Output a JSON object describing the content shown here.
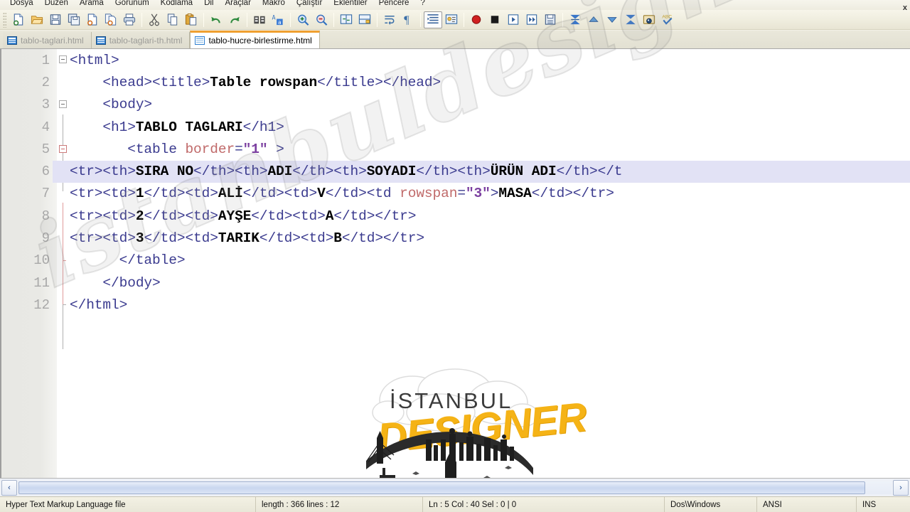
{
  "app": {
    "name": "Notepad++",
    "accent_active_tab": "#f0a030",
    "editor_bg": "#ffffff",
    "highlight_line_bg": "#e2e2f5"
  },
  "menubar": {
    "items": [
      {
        "label": "Dosya"
      },
      {
        "label": "Düzen"
      },
      {
        "label": "Arama"
      },
      {
        "label": "Görünüm"
      },
      {
        "label": "Kodlama"
      },
      {
        "label": "Dil"
      },
      {
        "label": "Araçlar"
      },
      {
        "label": "Makro"
      },
      {
        "label": "Çalıştır"
      },
      {
        "label": "Eklentiler"
      },
      {
        "label": "Pencere"
      },
      {
        "label": "?"
      }
    ]
  },
  "toolbar": {
    "groups": [
      [
        "new-file-icon",
        "open-folder-icon",
        "save-icon",
        "save-all-icon",
        "close-file-icon",
        "close-all-icon",
        "print-icon"
      ],
      [
        "cut-icon",
        "copy-icon",
        "paste-icon"
      ],
      [
        "undo-icon",
        "redo-icon"
      ],
      [
        "find-icon",
        "replace-icon"
      ],
      [
        "zoom-in-icon",
        "zoom-out-icon"
      ],
      [
        "sync-vertical-icon",
        "sync-horizontal-icon"
      ],
      [
        "word-wrap-icon",
        "show-all-chars-icon"
      ],
      [
        "indent-guide-icon",
        "user-language-icon"
      ],
      [
        "record-macro-icon",
        "stop-macro-icon",
        "play-macro-icon",
        "run-multiple-macro-icon",
        "save-macro-icon"
      ],
      [
        "collapse-all-icon",
        "collapse-level-icon",
        "expand-level-icon",
        "expand-all-icon",
        "launch-browser-icon",
        "spellcheck-icon"
      ]
    ],
    "pressed": "indent-guide-icon"
  },
  "tabs": {
    "close_label": "x",
    "items": [
      {
        "label": "tablo-taglari.html",
        "active": false,
        "icon": "html-file-icon"
      },
      {
        "label": "tablo-taglari-th.html",
        "active": false,
        "icon": "html-file-icon"
      },
      {
        "label": "tablo-hucre-birlestirme.html",
        "active": true,
        "icon": "html-file-icon"
      }
    ]
  },
  "editor": {
    "lines": [
      {
        "num": "1",
        "fold": "open",
        "highlight": false,
        "tokens": [
          {
            "t": "tk",
            "s": "<html>"
          }
        ]
      },
      {
        "num": "2",
        "fold": "none",
        "highlight": false,
        "tokens": [
          {
            "t": "tk",
            "s": "    <head><title>"
          },
          {
            "t": "txt",
            "s": "Table rowspan"
          },
          {
            "t": "tk",
            "s": "</title></head>"
          }
        ]
      },
      {
        "num": "3",
        "fold": "open",
        "highlight": false,
        "tokens": [
          {
            "t": "tk",
            "s": "    <body>"
          }
        ]
      },
      {
        "num": "4",
        "fold": "none",
        "highlight": false,
        "tokens": [
          {
            "t": "tk",
            "s": "    <h1>"
          },
          {
            "t": "txt",
            "s": "TABLO TAGLARI"
          },
          {
            "t": "tk",
            "s": "</h1>"
          }
        ]
      },
      {
        "num": "5",
        "fold": "open-active",
        "highlight": false,
        "tokens": [
          {
            "t": "tk",
            "s": "       <table "
          },
          {
            "t": "attr",
            "s": "border"
          },
          {
            "t": "tk",
            "s": "="
          },
          {
            "t": "val",
            "s": "\"1\""
          },
          {
            "t": "tk",
            "s": " >"
          }
        ]
      },
      {
        "num": "6",
        "fold": "none",
        "highlight": true,
        "tokens": [
          {
            "t": "tk",
            "s": "<tr><th>"
          },
          {
            "t": "txt",
            "s": "SIRA NO"
          },
          {
            "t": "tk",
            "s": "</th><th>"
          },
          {
            "t": "txt",
            "s": "ADI"
          },
          {
            "t": "tk",
            "s": "</th><th>"
          },
          {
            "t": "txt",
            "s": "SOYADI"
          },
          {
            "t": "tk",
            "s": "</th><th>"
          },
          {
            "t": "txt",
            "s": "ÜRÜN ADI"
          },
          {
            "t": "tk",
            "s": "</th></t"
          }
        ]
      },
      {
        "num": "7",
        "fold": "none",
        "highlight": false,
        "tokens": [
          {
            "t": "tk",
            "s": "<tr><td>"
          },
          {
            "t": "txt",
            "s": "1"
          },
          {
            "t": "tk",
            "s": "</td><td>"
          },
          {
            "t": "txt",
            "s": "ALİ"
          },
          {
            "t": "tk",
            "s": "</td><td>"
          },
          {
            "t": "txt",
            "s": "V"
          },
          {
            "t": "tk",
            "s": "</td><td "
          },
          {
            "t": "attr",
            "s": "rowspan"
          },
          {
            "t": "tk",
            "s": "="
          },
          {
            "t": "val",
            "s": "\"3\""
          },
          {
            "t": "tk",
            "s": ">"
          },
          {
            "t": "txt",
            "s": "MASA"
          },
          {
            "t": "tk",
            "s": "</td></tr>"
          }
        ]
      },
      {
        "num": "8",
        "fold": "none",
        "highlight": false,
        "tokens": [
          {
            "t": "tk",
            "s": "<tr><td>"
          },
          {
            "t": "txt",
            "s": "2"
          },
          {
            "t": "tk",
            "s": "</td><td>"
          },
          {
            "t": "txt",
            "s": "AYŞE"
          },
          {
            "t": "tk",
            "s": "</td><td>"
          },
          {
            "t": "txt",
            "s": "A"
          },
          {
            "t": "tk",
            "s": "</td></tr>"
          }
        ]
      },
      {
        "num": "9",
        "fold": "none",
        "highlight": false,
        "tokens": [
          {
            "t": "tk",
            "s": "<tr><td>"
          },
          {
            "t": "txt",
            "s": "3"
          },
          {
            "t": "tk",
            "s": "</td><td>"
          },
          {
            "t": "txt",
            "s": "TARIK"
          },
          {
            "t": "tk",
            "s": "</td><td>"
          },
          {
            "t": "txt",
            "s": "B"
          },
          {
            "t": "tk",
            "s": "</td></tr>"
          }
        ]
      },
      {
        "num": "10",
        "fold": "none",
        "highlight": false,
        "tokens": [
          {
            "t": "tk",
            "s": "      </table>"
          }
        ]
      },
      {
        "num": "11",
        "fold": "none",
        "highlight": false,
        "tokens": [
          {
            "t": "tk",
            "s": "    </body>"
          }
        ]
      },
      {
        "num": "12",
        "fold": "none",
        "highlight": false,
        "tokens": [
          {
            "t": "tk",
            "s": "</html>"
          }
        ]
      }
    ]
  },
  "scrollbar": {
    "left_arrow": "‹",
    "right_arrow": "›"
  },
  "statusbar": {
    "filetype": "Hyper Text Markup Language file",
    "length_lines": "length : 366   lines : 12",
    "caret": "Ln : 5   Col : 40   Sel : 0 | 0",
    "eol": "Dos\\Windows",
    "encoding": "ANSI",
    "insert_mode": "INS"
  },
  "watermark": {
    "diagonal_text": "istanbuldesigner.com",
    "logo_top": "İSTANBUL",
    "logo_bottom": "DESIGNER"
  }
}
